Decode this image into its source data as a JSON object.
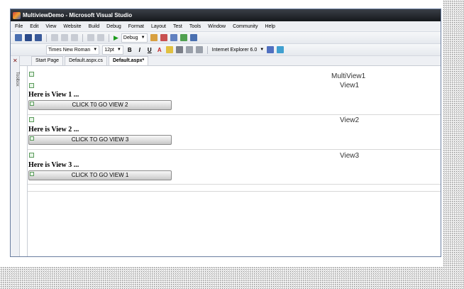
{
  "window": {
    "title": "MultiviewDemo - Microsoft Visual Studio"
  },
  "menubar": {
    "items": [
      "File",
      "Edit",
      "View",
      "Website",
      "Build",
      "Debug",
      "Format",
      "Layout",
      "Test",
      "Tools",
      "Window",
      "Community",
      "Help"
    ]
  },
  "toolbar1": {
    "configuration": "Debug"
  },
  "toolbar2": {
    "font_name": "Times New Roman",
    "font_size": "12pt",
    "bold": "B",
    "italic": "I",
    "underline": "U",
    "target_browser": "Internet Explorer 6.0"
  },
  "toolbox": {
    "label": "Toolbox"
  },
  "tabs": [
    {
      "label": "Start Page"
    },
    {
      "label": "Default.aspx.cs"
    },
    {
      "label": "Default.aspx*"
    }
  ],
  "design": {
    "multiview_label": "MultiView1",
    "views": [
      {
        "label": "View1",
        "text": "Here is View 1 ...",
        "button": "CLICK T0 GO VIEW 2"
      },
      {
        "label": "View2",
        "text": "Here is View 2 ...",
        "button": "CLICK TO GO VIEW 3"
      },
      {
        "label": "View3",
        "text": "Here is View 3 ...",
        "button": "CLICK TO GO VIEW 1"
      }
    ]
  }
}
